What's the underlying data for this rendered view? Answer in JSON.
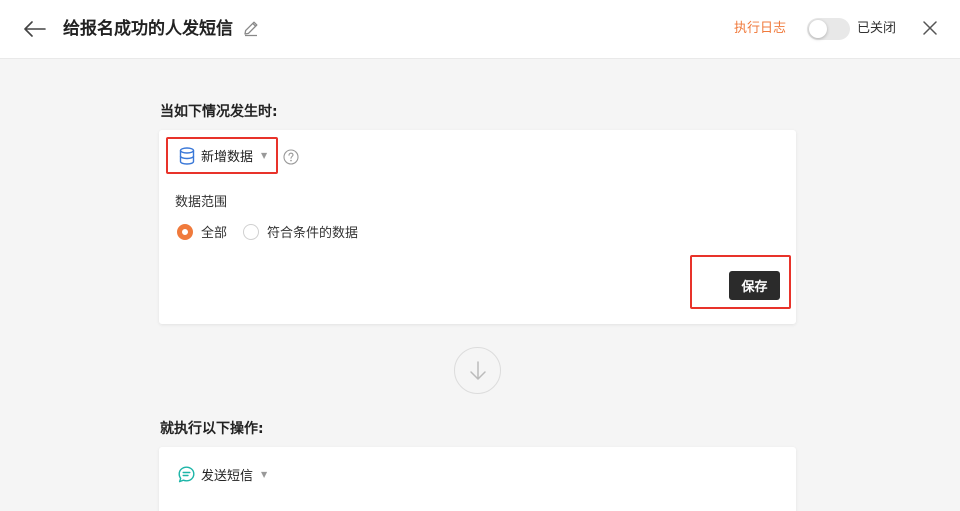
{
  "header": {
    "title": "给报名成功的人发短信",
    "log_label": "执行日志",
    "toggle_label": "已关闭",
    "toggle_on": false
  },
  "trigger": {
    "heading": "当如下情况发生时:",
    "select_label": "新增数据",
    "range_label": "数据范围",
    "options": [
      {
        "label": "全部",
        "checked": true
      },
      {
        "label": "符合条件的数据",
        "checked": false
      }
    ],
    "save_label": "保存"
  },
  "action": {
    "heading": "就执行以下操作:",
    "select_label": "发送短信"
  },
  "colors": {
    "accent": "#f07a3c",
    "highlight": "#e8332a",
    "db_icon": "#3a78d8",
    "sms_icon": "#1db5a8"
  },
  "icons": {
    "back": "arrow-left-icon",
    "edit": "pencil-icon",
    "close": "close-icon",
    "database": "database-icon",
    "help": "question-circle-icon",
    "connector": "arrow-down-icon",
    "sms": "chat-bubble-icon"
  }
}
